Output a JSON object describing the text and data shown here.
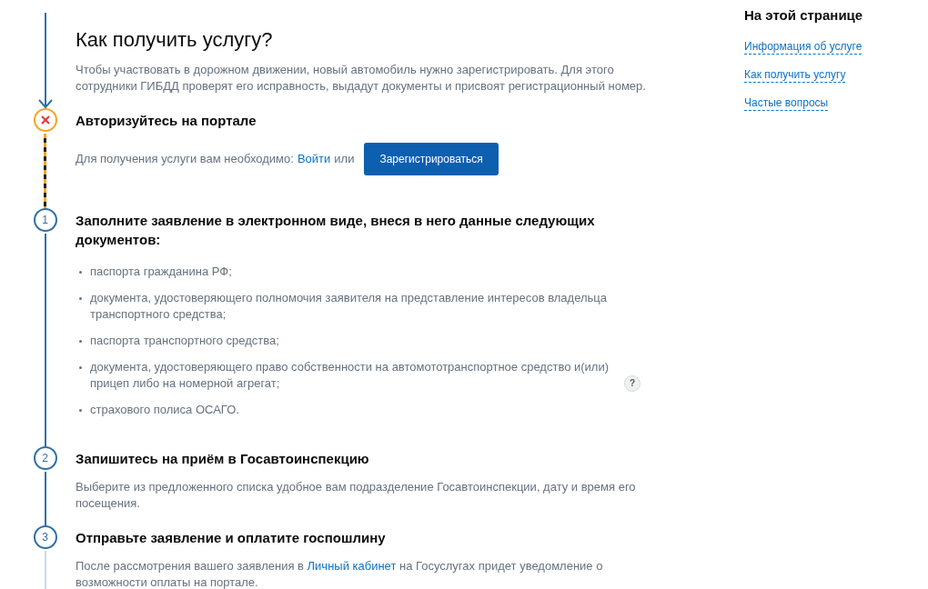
{
  "title": "Как получить услугу?",
  "intro": "Чтобы участвовать в дорожном движении, новый автомобиль нужно зарегистрировать. Для этого сотрудники ГИБДД проверят его исправность, выдадут документы и присвоят регистрационный номер.",
  "steps": [
    {
      "kind": "error",
      "title": "Авторизуйтесь на портале",
      "auth": {
        "text": "Для получения услуги вам необходимо:",
        "login_link": "Войти",
        "or": "или",
        "button": "Зарегистрироваться"
      }
    },
    {
      "kind": "number",
      "number": "1",
      "title": "Заполните заявление в электронном виде, внеся в него данные следующих документов:",
      "items": [
        {
          "text": "паспорта гражданина РФ;",
          "help": false
        },
        {
          "text": "документа, удостоверяющего полномочия заявителя на представление интересов владельца транспортного средства;",
          "help": false
        },
        {
          "text": "паспорта транспортного средства;",
          "help": false
        },
        {
          "text": "документа, удостоверяющего право собственности на автомототранспортное средство и(или) прицеп либо на номерной агрегат;",
          "help": true,
          "help_label": "?"
        },
        {
          "text": "страхового полиса ОСАГО.",
          "help": false
        }
      ]
    },
    {
      "kind": "number",
      "number": "2",
      "title": "Запишитесь на приём в Госавтоинспекцию",
      "body": [
        {
          "text": "Выберите из предложенного списка удобное вам подразделение Госавтоинспекции, дату и время его посещения."
        }
      ]
    },
    {
      "kind": "number",
      "number": "3",
      "title": "Отправьте заявление и оплатите госпошлину",
      "body": [
        {
          "text": "После рассмотрения вашего заявления в "
        },
        {
          "link": "Личный кабинет"
        },
        {
          "text": " на Госуслугах придет уведомление о возможности оплаты на портале."
        }
      ]
    }
  ],
  "sidebar": {
    "heading": "На этой странице",
    "links": [
      "Информация об услуге",
      "Как получить услугу",
      "Частые вопросы"
    ]
  }
}
